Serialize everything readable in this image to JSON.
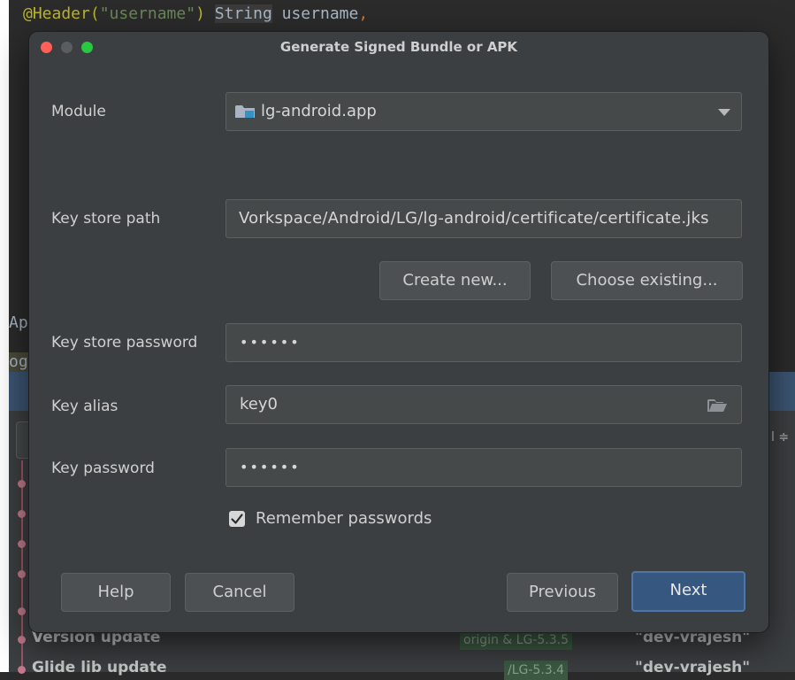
{
  "background": {
    "code_annotation": "@Header(",
    "code_string": "\"username\"",
    "code_paren_close": ")",
    "code_type": "String",
    "code_param": " username",
    "code_comma": ",",
    "paren_glyph": "(",
    "app_text": "App",
    "log_text": "og:",
    "right_mark": "l ≑",
    "git_rows": [
      {
        "message": "Version update",
        "tag": "origin & LG-5.3.5",
        "author": "\"dev-vrajesh\""
      },
      {
        "message": "Glide lib update",
        "tag": "/LG-5.3.4",
        "author": "\"dev-vrajesh\""
      }
    ]
  },
  "dialog": {
    "title": "Generate Signed Bundle or APK",
    "module": {
      "label": "Module",
      "value": "lg-android.app"
    },
    "key_store_path": {
      "label": "Key store path",
      "value": "Vorkspace/Android/LG/lg-android/certificate/certificate.jks"
    },
    "create_new_label": "Create new...",
    "choose_existing_label": "Choose existing...",
    "key_store_password": {
      "label": "Key store password",
      "value": "••••••"
    },
    "key_alias": {
      "label": "Key alias",
      "value": "key0"
    },
    "key_password": {
      "label": "Key password",
      "value": "••••••"
    },
    "remember_passwords": {
      "label": "Remember passwords",
      "checked": true
    },
    "buttons": {
      "help": "Help",
      "cancel": "Cancel",
      "previous": "Previous",
      "next": "Next"
    }
  },
  "colors": {
    "dialog_bg": "#3c3f41",
    "field_bg": "#45494a",
    "primary_button": "#365880",
    "traffic_red": "#ff5f57",
    "traffic_green": "#28c840"
  },
  "icons": [
    "folder-module-icon",
    "dropdown-arrow-icon",
    "folder-open-icon",
    "checkmark-icon"
  ]
}
